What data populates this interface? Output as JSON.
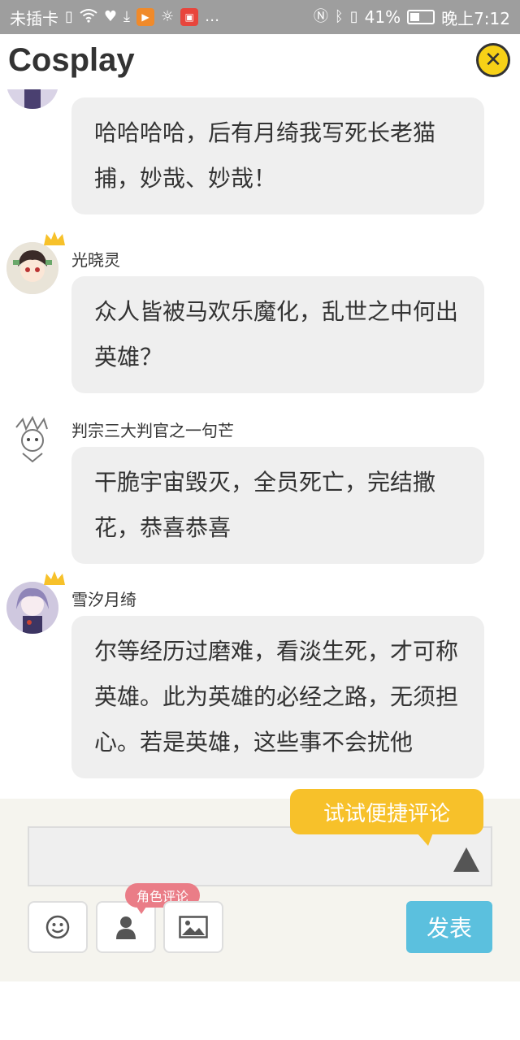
{
  "status_bar": {
    "carrier": "未插卡",
    "battery_percent": "41%",
    "time": "晚上7:12",
    "battery_level": 0.41
  },
  "header": {
    "title": "Cosplay"
  },
  "comments": [
    {
      "username": "",
      "text": "哈哈哈哈，后有月绮我写死长老猫捕，妙哉、妙哉！",
      "crown": false
    },
    {
      "username": "光晓灵",
      "text": "众人皆被马欢乐魔化，乱世之中何出英雄？",
      "crown": true
    },
    {
      "username": "判宗三大判官之一句芒",
      "text": "干脆宇宙毁灭，全员死亡，完结撒花，恭喜恭喜",
      "crown": false
    },
    {
      "username": "雪汐月绮",
      "text": "尔等经历过磨难，看淡生死，才可称英雄。此为英雄的必经之路，无须担心。若是英雄，这些事不会扰他",
      "crown": true
    }
  ],
  "composer": {
    "tip": "试试便捷评论",
    "role_badge": "角色评论",
    "post_label": "发表"
  },
  "colors": {
    "accent_yellow": "#f7c12a",
    "post_blue": "#5bc0de",
    "badge_pink": "#ea7d87"
  }
}
